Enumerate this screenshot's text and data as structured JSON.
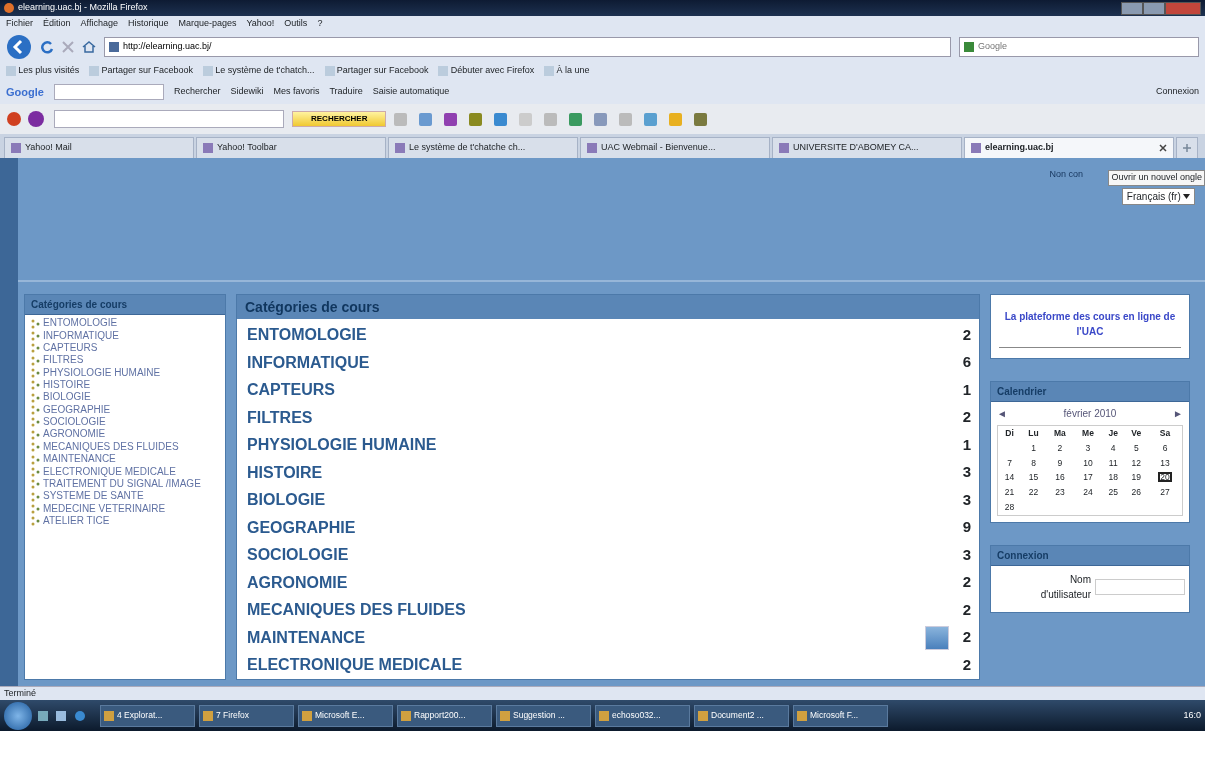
{
  "window": {
    "title": "elearning.uac.bj - Mozilla Firefox"
  },
  "menu": [
    "Fichier",
    "Édition",
    "Affichage",
    "Historique",
    "Marque-pages",
    "Yahoo!",
    "Outils",
    "?"
  ],
  "address": {
    "value": "http://elearning.uac.bj/"
  },
  "search": {
    "placeholder": "Google"
  },
  "bookmarks": [
    "Les plus visités",
    "Partager sur Facebook",
    "Le système de t'chatch...",
    "Partager sur Facebook",
    "Débuter avec Firefox",
    "À la une"
  ],
  "google_toolbar": {
    "logo": "Google",
    "items": [
      "Rechercher",
      "Sidewiki",
      "Mes favoris",
      "Traduire",
      "Saisie automatique"
    ],
    "signin": "Connexion"
  },
  "yahoo_toolbar": {
    "search_button": "RECHERCHER"
  },
  "tabs": [
    {
      "label": "Yahoo! Mail",
      "selected": false
    },
    {
      "label": "Yahoo! Toolbar",
      "selected": false
    },
    {
      "label": "Le système de t'chatche ch...",
      "selected": false
    },
    {
      "label": "UAC Webmail - Bienvenue...",
      "selected": false
    },
    {
      "label": "UNIVERSITE D'ABOMEY CA...",
      "selected": false
    },
    {
      "label": "elearning.uac.bj",
      "selected": true
    }
  ],
  "header": {
    "login_text": "Non con",
    "tooltip": "Ouvrir un nouvel ongle",
    "language": "Français (fr)"
  },
  "left_block": {
    "title": "Catégories de cours",
    "items": [
      "ENTOMOLOGIE",
      "INFORMATIQUE",
      "CAPTEURS",
      "FILTRES",
      "PHYSIOLOGIE HUMAINE",
      "HISTOIRE",
      "BIOLOGIE",
      "GEOGRAPHIE",
      "SOCIOLOGIE",
      "AGRONOMIE",
      "MECANIQUES DES FLUIDES",
      "MAINTENANCE",
      "ELECTRONIQUE MEDICALE",
      "TRAITEMENT DU SIGNAL /IMAGE",
      "SYSTEME DE SANTE",
      "MEDECINE VETERINAIRE",
      "ATELIER TICE"
    ]
  },
  "main": {
    "title": "Catégories de cours",
    "rows": [
      {
        "name": "ENTOMOLOGIE",
        "count": "2"
      },
      {
        "name": "INFORMATIQUE",
        "count": "6"
      },
      {
        "name": "CAPTEURS",
        "count": "1"
      },
      {
        "name": "FILTRES",
        "count": "2"
      },
      {
        "name": "PHYSIOLOGIE HUMAINE",
        "count": "1"
      },
      {
        "name": "HISTOIRE",
        "count": "3"
      },
      {
        "name": "BIOLOGIE",
        "count": "3"
      },
      {
        "name": "GEOGRAPHIE",
        "count": "9"
      },
      {
        "name": "SOCIOLOGIE",
        "count": "3"
      },
      {
        "name": "AGRONOMIE",
        "count": "2"
      },
      {
        "name": "MECANIQUES DES FLUIDES",
        "count": "2"
      },
      {
        "name": "MAINTENANCE",
        "count": "2"
      },
      {
        "name": "ELECTRONIQUE MEDICALE",
        "count": "2"
      }
    ]
  },
  "info_block": {
    "text": "La plateforme des cours en ligne de l'UAC"
  },
  "calendar": {
    "title": "Calendrier",
    "prev": "◄",
    "month": "février 2010",
    "next": "►",
    "weekdays": [
      "Di",
      "Lu",
      "Ma",
      "Me",
      "Je",
      "Ve",
      "Sa"
    ],
    "weeks": [
      {
        "kind": "first",
        "days": [
          {
            "day": "1",
            "today": false
          },
          {
            "day": "2",
            "today": false
          },
          {
            "day": "3",
            "today": false
          },
          {
            "day": "4",
            "today": false
          },
          {
            "day": "5",
            "today": false
          },
          {
            "day": "6",
            "today": false
          }
        ]
      },
      {
        "kind": "full",
        "days": [
          {
            "day": "7",
            "today": false
          },
          {
            "day": "8",
            "today": false
          },
          {
            "day": "9",
            "today": false
          },
          {
            "day": "10",
            "today": false
          },
          {
            "day": "11",
            "today": false
          },
          {
            "day": "12",
            "today": false
          },
          {
            "day": "13",
            "today": false
          }
        ]
      },
      {
        "kind": "full",
        "days": [
          {
            "day": "14",
            "today": false
          },
          {
            "day": "15",
            "today": false
          },
          {
            "day": "16",
            "today": false
          },
          {
            "day": "17",
            "today": false
          },
          {
            "day": "18",
            "today": false
          },
          {
            "day": "19",
            "today": false
          },
          {
            "day": "20",
            "today": true
          }
        ]
      },
      {
        "kind": "full",
        "days": [
          {
            "day": "21",
            "today": false
          },
          {
            "day": "22",
            "today": false
          },
          {
            "day": "23",
            "today": false
          },
          {
            "day": "24",
            "today": false
          },
          {
            "day": "25",
            "today": false
          },
          {
            "day": "26",
            "today": false
          },
          {
            "day": "27",
            "today": false
          }
        ]
      },
      {
        "kind": "last",
        "days": [
          {
            "day": "28",
            "today": false
          }
        ]
      }
    ]
  },
  "login_block": {
    "title": "Connexion",
    "username_label": "Nom d'utilisateur"
  },
  "status_bar": "Terminé",
  "taskbar": {
    "items": [
      "4 Explorat...",
      "7 Firefox",
      "Microsoft E...",
      "Rapport200...",
      "Suggestion ...",
      "echoso032...",
      "Document2 ...",
      "Microsoft F..."
    ],
    "clock": "16:0"
  }
}
